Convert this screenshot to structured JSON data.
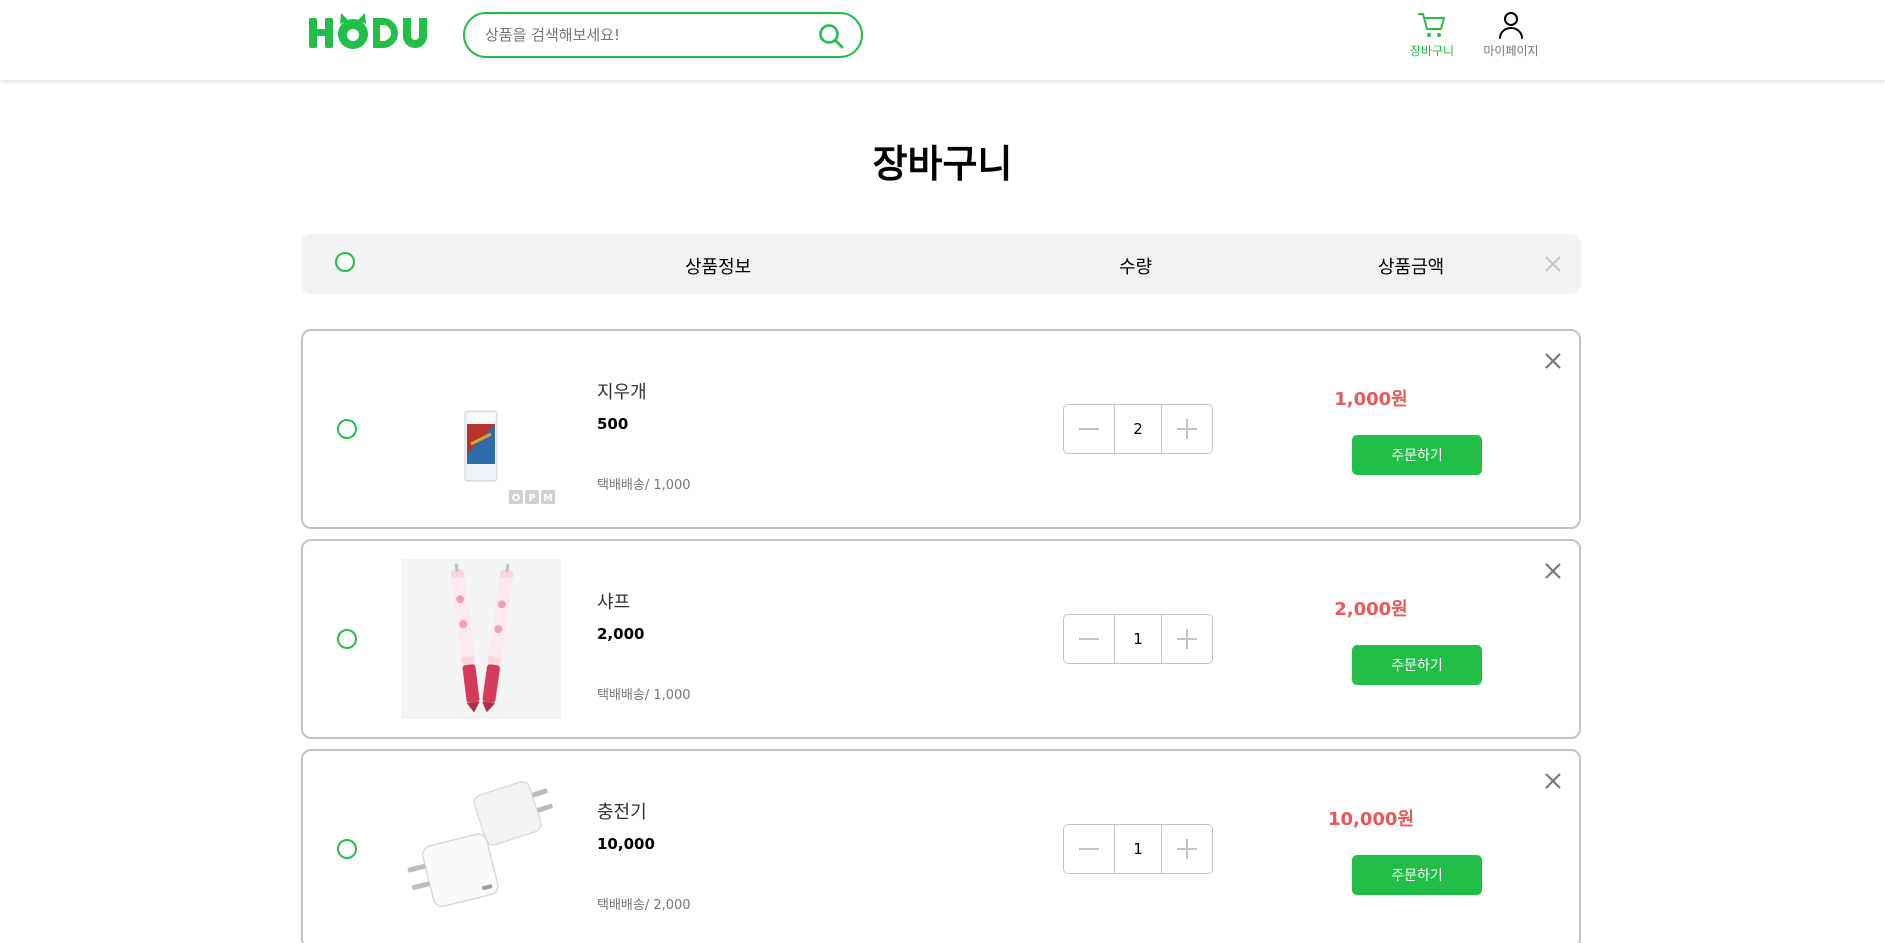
{
  "header": {
    "logo_text": "HODU",
    "search_placeholder": "상품을 검색해보세요!",
    "nav": {
      "cart_label": "장바구니",
      "mypage_label": "마이페이지"
    }
  },
  "page_title": "장바구니",
  "table_head": {
    "product_info": "상품정보",
    "quantity": "수량",
    "price": "상품금액"
  },
  "items": [
    {
      "name": "지우개",
      "unit_price": "500",
      "shipping": "택배배송/ 1,000",
      "quantity": "2",
      "total": "1,000원",
      "order_label": "주문하기",
      "image_icon": "eraser-image",
      "image_caption": "OPM"
    },
    {
      "name": "샤프",
      "unit_price": "2,000",
      "shipping": "택배배송/ 1,000",
      "quantity": "1",
      "total": "2,000원",
      "order_label": "주문하기",
      "image_icon": "mechanical-pencil-image"
    },
    {
      "name": "충전기",
      "unit_price": "10,000",
      "shipping": "택배배송/ 2,000",
      "quantity": "1",
      "total": "10,000원",
      "order_label": "주문하기",
      "image_icon": "charger-image"
    }
  ],
  "colors": {
    "brand_green": "#21BF48",
    "price_red": "#EB5757",
    "border_gray": "#C4C4C4",
    "head_bg": "#F2F2F2"
  }
}
